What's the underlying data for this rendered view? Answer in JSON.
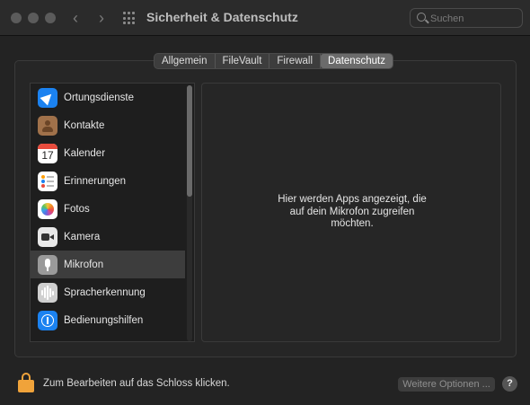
{
  "window": {
    "title": "Sicherheit & Datenschutz",
    "nav_back": "‹",
    "nav_forward": "›"
  },
  "search": {
    "placeholder": "Suchen",
    "value": ""
  },
  "tabs": [
    {
      "label": "Allgemein",
      "active": false
    },
    {
      "label": "FileVault",
      "active": false
    },
    {
      "label": "Firewall",
      "active": false
    },
    {
      "label": "Datenschutz",
      "active": true
    }
  ],
  "privacy_list": {
    "items": [
      {
        "label": "Ortungsdienste",
        "icon": "location-arrow-icon"
      },
      {
        "label": "Kontakte",
        "icon": "contacts-icon"
      },
      {
        "label": "Kalender",
        "icon": "calendar-icon",
        "icon_text": "17"
      },
      {
        "label": "Erinnerungen",
        "icon": "reminders-icon"
      },
      {
        "label": "Fotos",
        "icon": "photos-icon"
      },
      {
        "label": "Kamera",
        "icon": "camera-icon"
      },
      {
        "label": "Mikrofon",
        "icon": "microphone-icon",
        "selected": true
      },
      {
        "label": "Spracherkennung",
        "icon": "speech-recognition-icon"
      },
      {
        "label": "Bedienungshilfen",
        "icon": "accessibility-icon"
      }
    ]
  },
  "detail_panel": {
    "message": "Hier werden Apps angezeigt, die\nauf dein Mikrofon zugreifen\nmöchten."
  },
  "footer": {
    "lock_text": "Zum Bearbeiten auf das Schloss klicken.",
    "more_options_label": "Weitere Optionen ...",
    "help_label": "?"
  },
  "colors": {
    "accent_blue": "#1b82f0",
    "lock_orange": "#f0a33a",
    "selected_row": "#3d3d3d"
  }
}
